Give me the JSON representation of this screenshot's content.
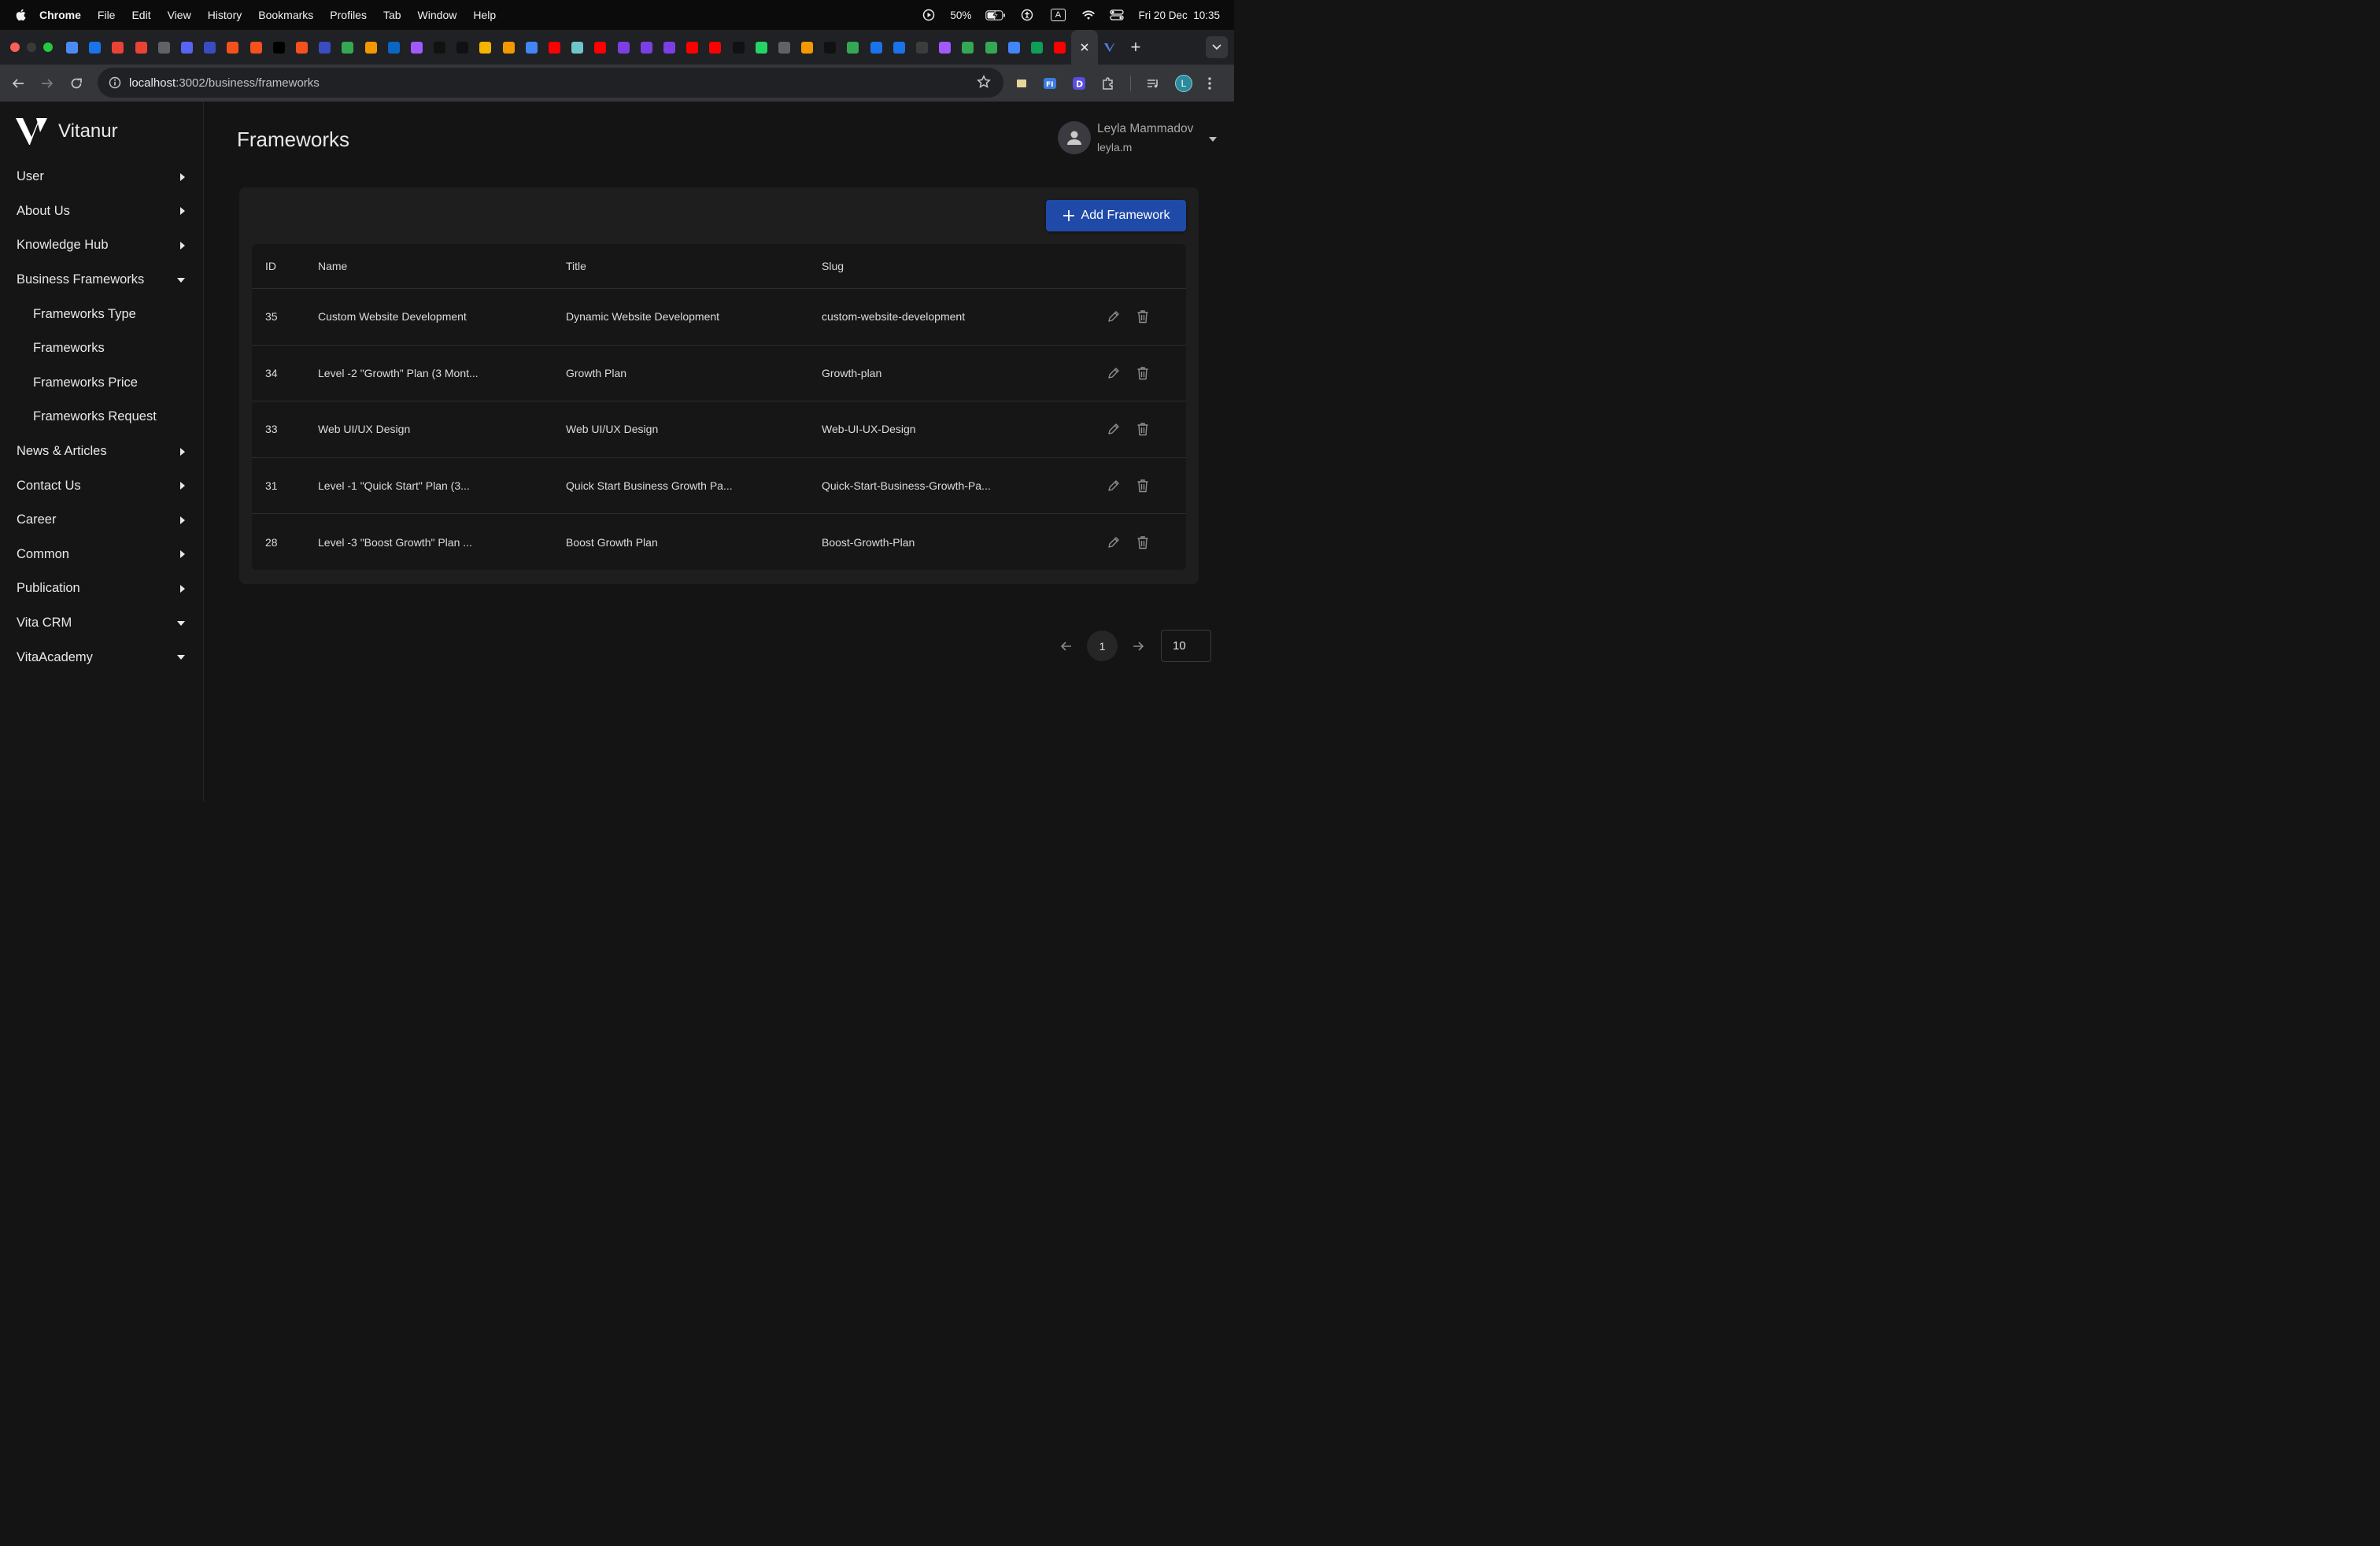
{
  "menubar": {
    "app": "Chrome",
    "items": [
      "File",
      "Edit",
      "View",
      "History",
      "Bookmarks",
      "Profiles",
      "Tab",
      "Window",
      "Help"
    ],
    "battery": "50%",
    "input_source": "A",
    "datetime": "Fri 20 Dec  10:35"
  },
  "browser": {
    "url_host": "localhost",
    "url_path": ":3002/business/frameworks",
    "profile_initial": "L",
    "tab_colors": [
      "#4c8bf5",
      "#1a73e8",
      "#ea4335",
      "#ea4335",
      "#5f6368",
      "#5865f2",
      "#3a4cc1",
      "#f4511e",
      "#f4511e",
      "#000000",
      "#f4511e",
      "#3a4cc1",
      "#34a853",
      "#f29900",
      "#0a66c2",
      "#a259ff",
      "#111111",
      "#111111",
      "#f4b400",
      "#f29900",
      "#4285f4",
      "#ff0000",
      "#6ec6ca",
      "#ff0000",
      "#7b3fe4",
      "#7b3fe4",
      "#7b3fe4",
      "#ff0000",
      "#ff0000",
      "#111111",
      "#25d366",
      "#5f6368",
      "#f29900",
      "#111111",
      "#34a853",
      "#1a73e8",
      "#1a73e8",
      "#3c3c3c",
      "#a259ff",
      "#34a853",
      "#34a853",
      "#4285f4",
      "#0f9d58",
      "#ff0000"
    ]
  },
  "brand": {
    "name": "Vitanur"
  },
  "sidebar": {
    "items": [
      {
        "label": "User",
        "caret": "right",
        "sub": false
      },
      {
        "label": "About Us",
        "caret": "right",
        "sub": false
      },
      {
        "label": "Knowledge Hub",
        "caret": "right",
        "sub": false
      },
      {
        "label": "Business Frameworks",
        "caret": "down",
        "sub": false
      },
      {
        "label": "Frameworks Type",
        "caret": "",
        "sub": true
      },
      {
        "label": "Frameworks",
        "caret": "",
        "sub": true
      },
      {
        "label": "Frameworks Price",
        "caret": "",
        "sub": true
      },
      {
        "label": "Frameworks Request",
        "caret": "",
        "sub": true
      },
      {
        "label": "News & Articles",
        "caret": "right",
        "sub": false
      },
      {
        "label": "Contact Us",
        "caret": "right",
        "sub": false
      },
      {
        "label": "Career",
        "caret": "right",
        "sub": false
      },
      {
        "label": "Common",
        "caret": "right",
        "sub": false
      },
      {
        "label": "Publication",
        "caret": "right",
        "sub": false
      },
      {
        "label": "Vita CRM",
        "caret": "down",
        "sub": false
      },
      {
        "label": "VitaAcademy",
        "caret": "down",
        "sub": false
      }
    ]
  },
  "header": {
    "title": "Frameworks",
    "user_name": "Leyla Mammadov",
    "user_login": "leyla.m"
  },
  "actions": {
    "add_label": "Add Framework"
  },
  "table": {
    "columns": {
      "id": "ID",
      "name": "Name",
      "title": "Title",
      "slug": "Slug"
    },
    "rows": [
      {
        "id": "35",
        "name": "Custom Website Development",
        "title": "Dynamic Website Development",
        "slug": "custom-website-development"
      },
      {
        "id": "34",
        "name": "Level -2 \"Growth\" Plan (3 Mont...",
        "title": "Growth Plan",
        "slug": "Growth-plan"
      },
      {
        "id": "33",
        "name": "Web UI/UX Design",
        "title": "Web UI/UX Design",
        "slug": "Web-UI-UX-Design"
      },
      {
        "id": "31",
        "name": "Level -1 \"Quick Start\" Plan (3...",
        "title": "Quick Start Business Growth Pa...",
        "slug": "Quick-Start-Business-Growth-Pa..."
      },
      {
        "id": "28",
        "name": "Level -3 \"Boost Growth\" Plan ...",
        "title": "Boost Growth Plan",
        "slug": "Boost-Growth-Plan"
      }
    ]
  },
  "pagination": {
    "current_page": "1",
    "page_size": "10"
  }
}
